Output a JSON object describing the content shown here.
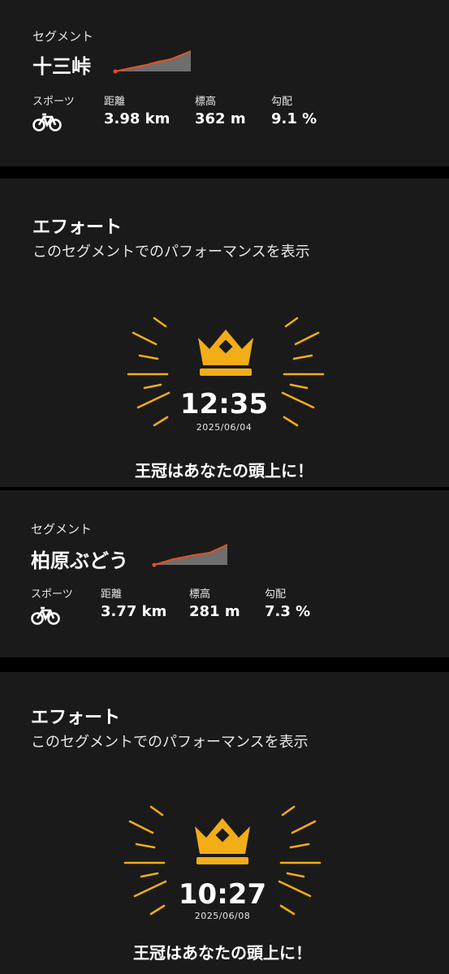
{
  "segment1": {
    "section_label": "セグメント",
    "name": "十三峠",
    "stats": [
      {
        "label": "スポーツ",
        "value": ""
      },
      {
        "label": "距離",
        "value": "3.98 km"
      },
      {
        "label": "標高",
        "value": "362 m"
      },
      {
        "label": "勾配",
        "value": "9.1 %"
      }
    ],
    "sport_icon": "bicycle-icon"
  },
  "effort1": {
    "title": "エフォート",
    "subtitle": "このセグメントでのパフォーマンスを表示",
    "time": "12:35",
    "date": "2025/06/04",
    "message": "王冠はあなたの頭上に！",
    "accent": "#f2ad17"
  },
  "segment2": {
    "section_label": "セグメント",
    "name": "柏原ぶどう",
    "stats": [
      {
        "label": "スポーツ",
        "value": ""
      },
      {
        "label": "距離",
        "value": "3.77 km"
      },
      {
        "label": "標高",
        "value": "281 m"
      },
      {
        "label": "勾配",
        "value": "7.3 %"
      }
    ],
    "sport_icon": "bicycle-icon"
  },
  "effort2": {
    "title": "エフォート",
    "subtitle": "このセグメントでのパフォーマンスを表示",
    "time": "10:27",
    "date": "2025/06/08",
    "message": "王冠はあなたの頭上に！",
    "accent": "#f2ad17"
  },
  "colors": {
    "panel": "#1a1a1a",
    "profile_line": "#e8501e",
    "profile_fill": "#6e6e6e",
    "crown": "#f2ad17"
  }
}
